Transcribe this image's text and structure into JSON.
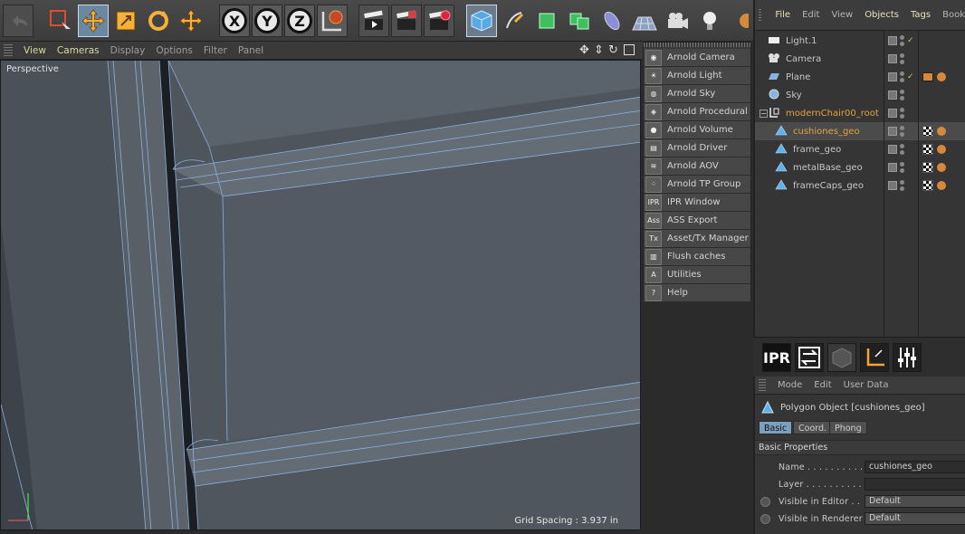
{
  "viewport_menu": [
    "View",
    "Cameras",
    "Display",
    "Options",
    "Filter",
    "Panel"
  ],
  "viewport": {
    "mode": "Perspective",
    "grid_spacing": "Grid Spacing : 3.937 in"
  },
  "toolbar": {
    "axis_x": "X",
    "axis_y": "Y",
    "axis_z": "Z"
  },
  "arnold_menu": [
    {
      "label": "Arnold Camera",
      "icon": "camera-icon",
      "glyph": "◉"
    },
    {
      "label": "Arnold Light",
      "icon": "bulb-icon",
      "glyph": "☀"
    },
    {
      "label": "Arnold Sky",
      "icon": "globe-icon",
      "glyph": "◍"
    },
    {
      "label": "Arnold Procedural",
      "icon": "cube-icon",
      "glyph": "◈"
    },
    {
      "label": "Arnold Volume",
      "icon": "volume-icon",
      "glyph": "●"
    },
    {
      "label": "Arnold Driver",
      "icon": "file-icon",
      "glyph": "▤"
    },
    {
      "label": "Arnold AOV",
      "icon": "layers-icon",
      "glyph": "≋"
    },
    {
      "label": "Arnold TP Group",
      "icon": "particles-icon",
      "glyph": "⁘"
    },
    {
      "label": "IPR Window",
      "icon": "ipr-icon",
      "glyph": "IPR"
    },
    {
      "label": "ASS Export",
      "icon": "ass-icon",
      "glyph": "Ass"
    },
    {
      "label": "Asset/Tx Manager",
      "icon": "tx-icon",
      "glyph": "Tx"
    },
    {
      "label": "Flush caches",
      "icon": "trash-icon",
      "glyph": "▥"
    },
    {
      "label": "Utilities",
      "icon": "arnold-logo-icon",
      "glyph": "A"
    },
    {
      "label": "Help",
      "icon": "help-icon",
      "glyph": "?"
    }
  ],
  "object_manager": {
    "menu": [
      "File",
      "Edit",
      "View",
      "Objects",
      "Tags",
      "Book"
    ],
    "objects": [
      {
        "name": "Light.1",
        "indent": 0,
        "icon": "light-icon",
        "check": true,
        "tags": []
      },
      {
        "name": "Camera",
        "indent": 0,
        "icon": "camera-icon",
        "check": false,
        "tags": []
      },
      {
        "name": "Plane",
        "indent": 0,
        "icon": "plane-icon",
        "check": true,
        "tags": [
          "clapper",
          "ball"
        ]
      },
      {
        "name": "Sky",
        "indent": 0,
        "icon": "sky-icon",
        "check": false,
        "tags": []
      },
      {
        "name": "modernChair00_root",
        "indent": 0,
        "icon": "null-icon",
        "check": false,
        "tags": [],
        "orange": true
      },
      {
        "name": "cushiones_geo",
        "indent": 1,
        "icon": "polygon-icon",
        "check": false,
        "tags": [
          "tex",
          "ball"
        ],
        "orange": true,
        "selected": true
      },
      {
        "name": "frame_geo",
        "indent": 1,
        "icon": "polygon-icon",
        "check": false,
        "tags": [
          "tex",
          "ball"
        ]
      },
      {
        "name": "metalBase_geo",
        "indent": 1,
        "icon": "polygon-icon",
        "check": false,
        "tags": [
          "tex",
          "ball"
        ]
      },
      {
        "name": "frameCaps_geo",
        "indent": 1,
        "icon": "polygon-icon",
        "check": false,
        "tags": [
          "tex",
          "ball"
        ]
      }
    ]
  },
  "ipr_bar": {
    "ipr_label": "IPR"
  },
  "attributes": {
    "menu": [
      "Mode",
      "Edit",
      "User Data"
    ],
    "object_title": "Polygon Object [cushiones_geo]",
    "tabs": [
      "Basic",
      "Coord.",
      "Phong"
    ],
    "section": "Basic Properties",
    "props": [
      {
        "label": "Name . . . . . . . . . .",
        "value": "cushiones_geo",
        "radio": false,
        "dropdown": false
      },
      {
        "label": "Layer . . . . . . . . . .",
        "value": "",
        "radio": false,
        "dropdown": false
      },
      {
        "label": "Visible in Editor . .",
        "value": "Default",
        "radio": true,
        "dropdown": true
      },
      {
        "label": "Visible in Renderer",
        "value": "Default",
        "radio": true,
        "dropdown": true
      }
    ]
  },
  "colors": {
    "accent": "#6c87a0",
    "orange": "#e3a140",
    "viewport": "#4e555d"
  }
}
